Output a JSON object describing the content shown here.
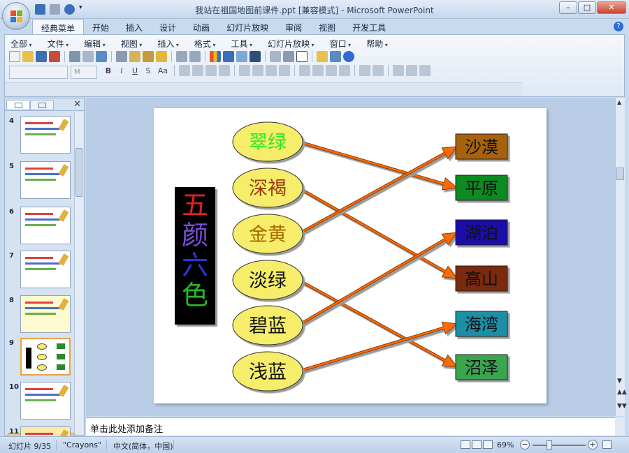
{
  "window": {
    "title": "我站在祖国地图前课件.ppt [兼容模式] - Microsoft PowerPoint",
    "minimize": "–",
    "maximize": "□",
    "close": "✕"
  },
  "ribbon_tabs": [
    {
      "label": "经典菜单",
      "active": true
    },
    {
      "label": "开始"
    },
    {
      "label": "插入"
    },
    {
      "label": "设计"
    },
    {
      "label": "动画"
    },
    {
      "label": "幻灯片放映"
    },
    {
      "label": "审阅"
    },
    {
      "label": "视图"
    },
    {
      "label": "开发工具"
    }
  ],
  "menus": [
    "全部",
    "文件",
    "编辑",
    "视图",
    "插入",
    "格式",
    "工具",
    "幻灯片放映",
    "窗口",
    "帮助"
  ],
  "help_icon": "?",
  "font_size_placeholder": "M",
  "format_buttons": [
    "B",
    "I",
    "U",
    "S",
    "Aa"
  ],
  "slide_panel": {
    "close": "✕",
    "slides": [
      {
        "number": "4"
      },
      {
        "number": "5"
      },
      {
        "number": "6"
      },
      {
        "number": "7"
      },
      {
        "number": "8"
      },
      {
        "number": "9",
        "selected": true
      },
      {
        "number": "10"
      },
      {
        "number": "11"
      }
    ]
  },
  "slide": {
    "title_chars": [
      {
        "text": "五",
        "color": "#e02020"
      },
      {
        "text": "颜",
        "color": "#7d4fd8"
      },
      {
        "text": "六",
        "color": "#3030e0"
      },
      {
        "text": "色",
        "color": "#22bb22"
      }
    ],
    "left_items": [
      {
        "text": "翠绿",
        "color": "#22ee22"
      },
      {
        "text": "深褐",
        "color": "#9a3a10"
      },
      {
        "text": "金黄",
        "color": "#a86a00"
      },
      {
        "text": "淡绿",
        "color": "#111111"
      },
      {
        "text": "碧蓝",
        "color": "#111111"
      },
      {
        "text": "浅蓝",
        "color": "#111111"
      }
    ],
    "right_items": [
      {
        "text": "沙漠",
        "bg": "#a8620e"
      },
      {
        "text": "平原",
        "bg": "#0f8a20"
      },
      {
        "text": "湖泊",
        "bg": "#1a0fa8"
      },
      {
        "text": "高山",
        "bg": "#7a2a0a"
      },
      {
        "text": "海湾",
        "bg": "#1a8fa6"
      },
      {
        "text": "沼泽",
        "bg": "#3aa450"
      }
    ],
    "links": [
      [
        0,
        1
      ],
      [
        1,
        3
      ],
      [
        2,
        0
      ],
      [
        3,
        5
      ],
      [
        4,
        2
      ],
      [
        5,
        4
      ]
    ],
    "ellipse_color": "#f6ee6a",
    "arrow_color": "#ff6a00"
  },
  "notes_placeholder": "单击此处添加备注",
  "status": {
    "slide_info": "幻灯片 9/35",
    "theme": "\"Crayons\"",
    "language": "中文(简体，中国)",
    "zoom": "69%",
    "zoom_level_fraction": 0.69
  }
}
